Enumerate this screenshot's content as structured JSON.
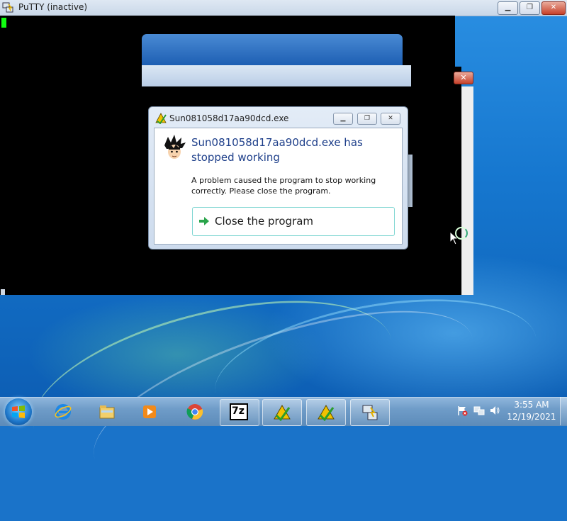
{
  "putty": {
    "title": "PuTTY (inactive)"
  },
  "dialog": {
    "title": "Sun081058d17aa90dcd.exe",
    "headline": "Sun081058d17aa90dcd.exe has stopped working",
    "description": "A problem caused the program to stop working correctly. Please close the program.",
    "close_button_label": "Close the program",
    "accent": "#1e3f8a"
  },
  "taskbar": {
    "items": [
      {
        "icon": "internet-explorer-icon"
      },
      {
        "icon": "file-explorer-icon"
      },
      {
        "icon": "media-player-icon"
      },
      {
        "icon": "chrome-icon"
      },
      {
        "icon": "7zip-icon",
        "label": "7z"
      },
      {
        "icon": "app-warning-icon"
      },
      {
        "icon": "app-warning-icon"
      },
      {
        "icon": "putty-icon"
      }
    ],
    "clock_time": "3:55 AM",
    "clock_date": "12/19/2021"
  }
}
